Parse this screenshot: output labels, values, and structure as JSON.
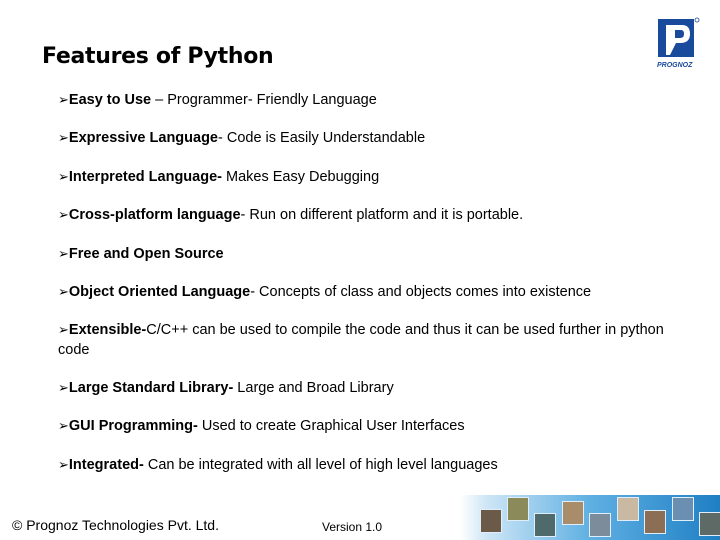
{
  "slide": {
    "title": "Features of Python",
    "bullet_glyph": "➢",
    "items": [
      {
        "term": "Easy to Use",
        "desc": " – Programmer- Friendly Language"
      },
      {
        "term": "Expressive  Language",
        "desc": "- Code is Easily Understandable"
      },
      {
        "term": "Interpreted Language-",
        "desc": " Makes  Easy Debugging"
      },
      {
        "term": "Cross-platform language",
        "desc": "- Run on different platform and it is portable."
      },
      {
        "term": "Free and Open Source",
        "desc": ""
      },
      {
        "term": "Object Oriented Language",
        "desc": "- Concepts of class  and objects comes into existence"
      },
      {
        "term": "Extensible-",
        "desc": "C/C++ can be used to compile the code and thus it can be  used further in python code"
      },
      {
        "term": "Large Standard Library-",
        "desc": " Large and Broad Library"
      },
      {
        "term": "GUI Programming-",
        "desc": " Used to create Graphical User Interfaces"
      },
      {
        "term": "Integrated-",
        "desc": "  Can be integrated with all level of high level languages"
      }
    ]
  },
  "logo": {
    "letter": "P",
    "brand": "PROGNOZ",
    "registered": "®",
    "color": "#1a4a9c"
  },
  "footer": {
    "copyright": "© Prognoz Technologies Pvt. Ltd.",
    "version": "Version 1.0"
  }
}
